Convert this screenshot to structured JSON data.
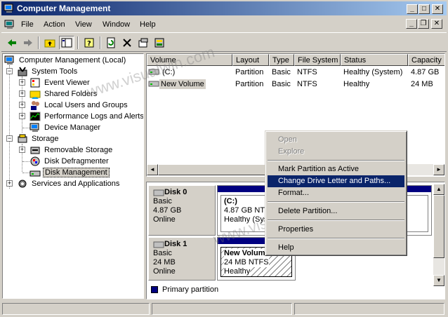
{
  "window": {
    "title": "Computer Management",
    "min": "_",
    "max": "□",
    "close": "✕"
  },
  "menubar": {
    "items": [
      "File",
      "Action",
      "View",
      "Window",
      "Help"
    ],
    "mdi_min": "_",
    "mdi_restore": "❐",
    "mdi_close": "✕"
  },
  "toolbar": {
    "buttons": [
      "back-icon",
      "forward-icon",
      "up-folder-icon",
      "show-hide-tree-icon",
      "help-icon",
      "delete-icon",
      "properties-icon",
      "export-icon"
    ]
  },
  "tree": {
    "root": "Computer Management (Local)",
    "system_tools": "System Tools",
    "event_viewer": "Event Viewer",
    "shared_folders": "Shared Folders",
    "local_users": "Local Users and Groups",
    "perf_logs": "Performance Logs and Alerts",
    "device_manager": "Device Manager",
    "storage": "Storage",
    "removable_storage": "Removable Storage",
    "defrag": "Disk Defragmenter",
    "disk_management": "Disk Management",
    "services": "Services and Applications",
    "expand": "+",
    "collapse": "−"
  },
  "volume_list": {
    "columns": [
      "Volume",
      "Layout",
      "Type",
      "File System",
      "Status",
      "Capacity"
    ],
    "rows": [
      [
        "(C:)",
        "Partition",
        "Basic",
        "NTFS",
        "Healthy (System)",
        "4.87 GB"
      ],
      [
        "New Volume",
        "Partition",
        "Basic",
        "NTFS",
        "Healthy",
        "24 MB"
      ]
    ]
  },
  "disks": [
    {
      "name": "Disk 0",
      "type": "Basic",
      "size": "4.87 GB",
      "state": "Online",
      "partition": {
        "label": "(C:)",
        "size_fs": "4.87 GB NTFS",
        "status": "Healthy (System)"
      }
    },
    {
      "name": "Disk 1",
      "type": "Basic",
      "size": "24 MB",
      "state": "Online",
      "partition": {
        "label": "New Volume",
        "size_fs": "24 MB NTFS",
        "status": "Healthy"
      }
    }
  ],
  "legend": {
    "primary": "Primary partition"
  },
  "scroll": {
    "left": "◄",
    "right": "►",
    "up": "▲",
    "down": "▼"
  },
  "context_menu": {
    "open": "Open",
    "explore": "Explore",
    "mark_active": "Mark Partition as Active",
    "change_letter": "Change Drive Letter and Paths...",
    "format": "Format...",
    "delete": "Delete Partition...",
    "properties": "Properties",
    "help": "Help"
  },
  "watermark": "www.visualwin.com",
  "colors": {
    "title_bar": "#0a246a",
    "selection": "#0a246a",
    "primary_partition": "#000080",
    "face": "#d4d0c8"
  }
}
